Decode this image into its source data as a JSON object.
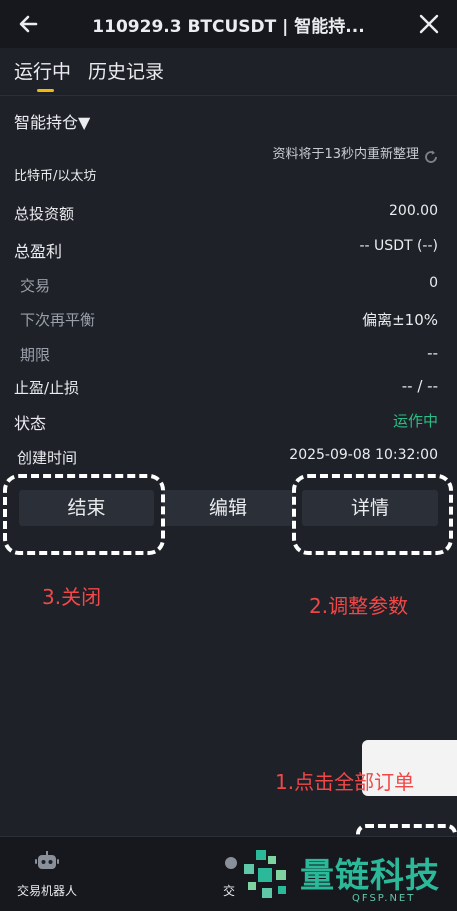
{
  "header": {
    "title": "110929.3 BTCUSDT | 智能持..."
  },
  "tabs": [
    {
      "label": "运行中"
    },
    {
      "label": "历史记录"
    }
  ],
  "bot": {
    "section_label": "智能持仓▼",
    "refresh_notice": "资料将于13秒内重新整理",
    "pair_label": "比特币/以太坊",
    "fields": {
      "total_investment": {
        "label": "总投资额",
        "value": "200.00"
      },
      "total_profit": {
        "label": "总盈利",
        "value": "-- USDT (--)"
      },
      "trades": {
        "label": "交易",
        "value": "0"
      },
      "next_rebalance": {
        "label": "下次再平衡",
        "value": "偏离±10%"
      },
      "term": {
        "label": "期限",
        "value": "--"
      },
      "tp_sl": {
        "label": "止盈/止损",
        "value": "-- / --"
      },
      "status": {
        "label": "状态",
        "value": "运作中"
      },
      "created_time": {
        "label": "创建时间",
        "value": "2025-09-08 10:32:00"
      }
    }
  },
  "actions": {
    "end_label": "结束",
    "edit_label": "编辑",
    "details_label": "详情"
  },
  "annotations": {
    "close_note": "3.关闭",
    "adjust_note": "2.调整参数",
    "all_orders_note": "1.点击全部订单"
  },
  "bottom_nav": {
    "bot_label": "交易机器人",
    "trade_label_partial": "交"
  },
  "watermark": {
    "text": "量链科技",
    "sub": "QFSP.NET"
  },
  "colors": {
    "background": "#1e2128",
    "accent": "#f0b90b",
    "status_green": "#2ebd85",
    "annotation_red": "#f04848",
    "watermark_green": "#2bb99a"
  }
}
